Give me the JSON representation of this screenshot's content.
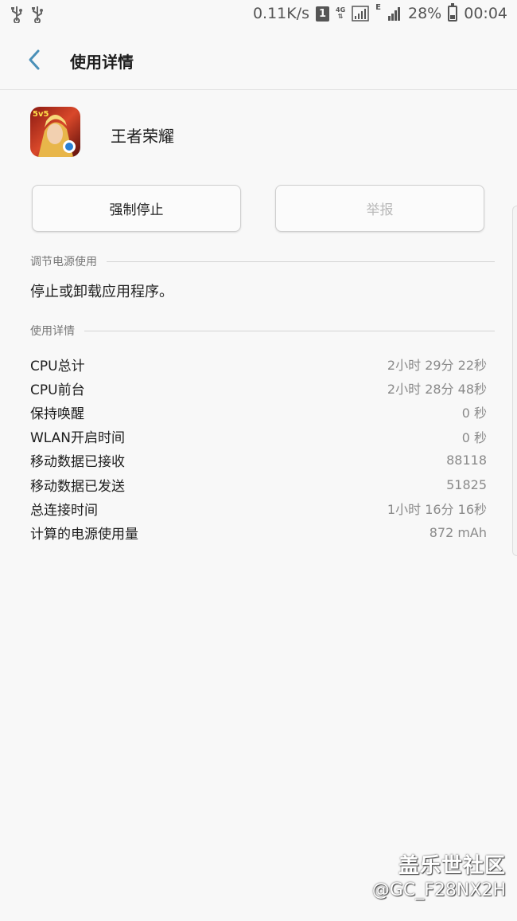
{
  "status_bar": {
    "net_speed": "0.11K/s",
    "sim_label": "1",
    "network_4g": "4G",
    "network_e": "E",
    "battery": "28%",
    "time": "00:04",
    "icons": [
      "usb-icon",
      "usb-icon",
      "sim-icon",
      "signal-icon",
      "battery-icon"
    ]
  },
  "header": {
    "title": "使用详情",
    "back_icon": "back-arrow-icon"
  },
  "app": {
    "name": "王者荣耀",
    "icon_badge": "5v5",
    "icon": "app-icon"
  },
  "buttons": {
    "force_stop": "强制停止",
    "report": "举报"
  },
  "power_section": {
    "label": "调节电源使用",
    "description": "停止或卸载应用程序。"
  },
  "usage_section": {
    "label": "使用详情",
    "rows": [
      {
        "label": "CPU总计",
        "value": "2小时 29分 22秒"
      },
      {
        "label": "CPU前台",
        "value": "2小时 28分 48秒"
      },
      {
        "label": "保持唤醒",
        "value": "0 秒"
      },
      {
        "label": "WLAN开启时间",
        "value": "0 秒"
      },
      {
        "label": "移动数据已接收",
        "value": "88118"
      },
      {
        "label": "移动数据已发送",
        "value": "51825"
      },
      {
        "label": "总连接时间",
        "value": "1小时 16分 16秒"
      },
      {
        "label": "计算的电源使用量",
        "value": "872 mAh"
      }
    ]
  },
  "watermark": {
    "site": "盖乐世社区",
    "user": "@GC_F28NX2H"
  },
  "colors": {
    "background": "#f8f8f8",
    "accent": "#4a90b8",
    "text": "#1d1d1d",
    "muted": "#8a8a8a"
  }
}
